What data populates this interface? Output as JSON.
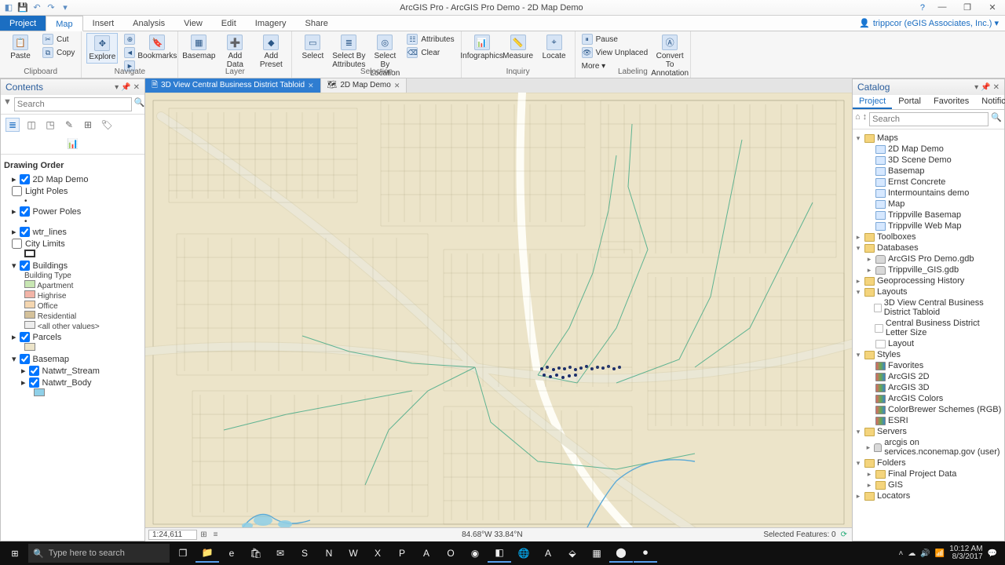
{
  "window": {
    "title": "ArcGIS Pro - ArcGIS Pro Demo - 2D Map Demo",
    "help_icon": "?",
    "min": "—",
    "max": "❐",
    "close": "✕",
    "user": "trippcor (eGIS Associates, Inc.) ▾"
  },
  "tabs": {
    "project": "Project",
    "items": [
      "Map",
      "Insert",
      "Analysis",
      "View",
      "Edit",
      "Imagery",
      "Share"
    ],
    "active": "Map"
  },
  "ribbon": {
    "clipboard": {
      "label": "Clipboard",
      "paste": "Paste",
      "cut": "Cut",
      "copy": "Copy"
    },
    "navigate": {
      "label": "Navigate",
      "explore": "Explore",
      "bookmarks": "Bookmarks"
    },
    "layer": {
      "label": "Layer",
      "basemap": "Basemap",
      "adddata": "Add Data",
      "addpreset": "Add Preset"
    },
    "selection": {
      "label": "Selection",
      "select": "Select",
      "byattr": "Select By Attributes",
      "byloc": "Select By Location",
      "attributes": "Attributes",
      "clear": "Clear"
    },
    "inquiry": {
      "label": "Inquiry",
      "infographics": "Infographics",
      "measure": "Measure",
      "locate": "Locate"
    },
    "labeling": {
      "label": "Labeling",
      "pause": "Pause",
      "viewunplaced": "View Unplaced",
      "more": "More ▾",
      "convert": "Convert To Annotation"
    }
  },
  "contents": {
    "title": "Contents",
    "search_placeholder": "Search",
    "drawing_order": "Drawing Order",
    "map": "2D Map Demo",
    "layers": {
      "light_poles": "Light Poles",
      "power_poles": "Power Poles",
      "wtr_lines": "wtr_lines",
      "city_limits": "City Limits",
      "buildings": "Buildings",
      "building_type": "Building Type",
      "bt_apartment": "Apartment",
      "bt_highrise": "Highrise",
      "bt_office": "Office",
      "bt_residential": "Residential",
      "bt_other": "<all other values>",
      "parcels": "Parcels",
      "basemap": "Basemap",
      "natwtr_stream": "Natwtr_Stream",
      "natwtr_body": "Natwtr_Body"
    }
  },
  "viewtabs": {
    "tab1": "3D View Central Business District Tabloid",
    "tab2": "2D Map Demo"
  },
  "status": {
    "scale": "1:24,611",
    "coords": "84.68°W 33.84°N",
    "selected": "Selected Features: 0"
  },
  "catalog": {
    "title": "Catalog",
    "tabs": {
      "project": "Project",
      "portal": "Portal",
      "favorites": "Favorites",
      "notification": "Notification"
    },
    "search_placeholder": "Search",
    "tree": {
      "maps": "Maps",
      "maps_items": [
        "2D Map Demo",
        "3D Scene Demo",
        "Basemap",
        "Ernst Concrete",
        "Intermountains demo",
        "Map",
        "Trippville Basemap",
        "Trippville Web Map"
      ],
      "toolboxes": "Toolboxes",
      "databases": "Databases",
      "db_items": [
        "ArcGIS Pro Demo.gdb",
        "Trippville_GIS.gdb"
      ],
      "geo_history": "Geoprocessing History",
      "layouts": "Layouts",
      "layout_items": [
        "3D View Central Business District Tabloid",
        "Central Business District Letter Size",
        "Layout"
      ],
      "styles": "Styles",
      "style_items": [
        "Favorites",
        "ArcGIS 2D",
        "ArcGIS 3D",
        "ArcGIS Colors",
        "ColorBrewer Schemes (RGB)",
        "ESRI"
      ],
      "servers": "Servers",
      "server_items": [
        "arcgis on services.nconemap.gov (user)"
      ],
      "folders": "Folders",
      "folder_items": [
        "Final Project Data",
        "GIS"
      ],
      "locators": "Locators"
    }
  },
  "taskbar": {
    "search": "Type here to search",
    "time": "10:12 AM",
    "date": "8/3/2017"
  }
}
